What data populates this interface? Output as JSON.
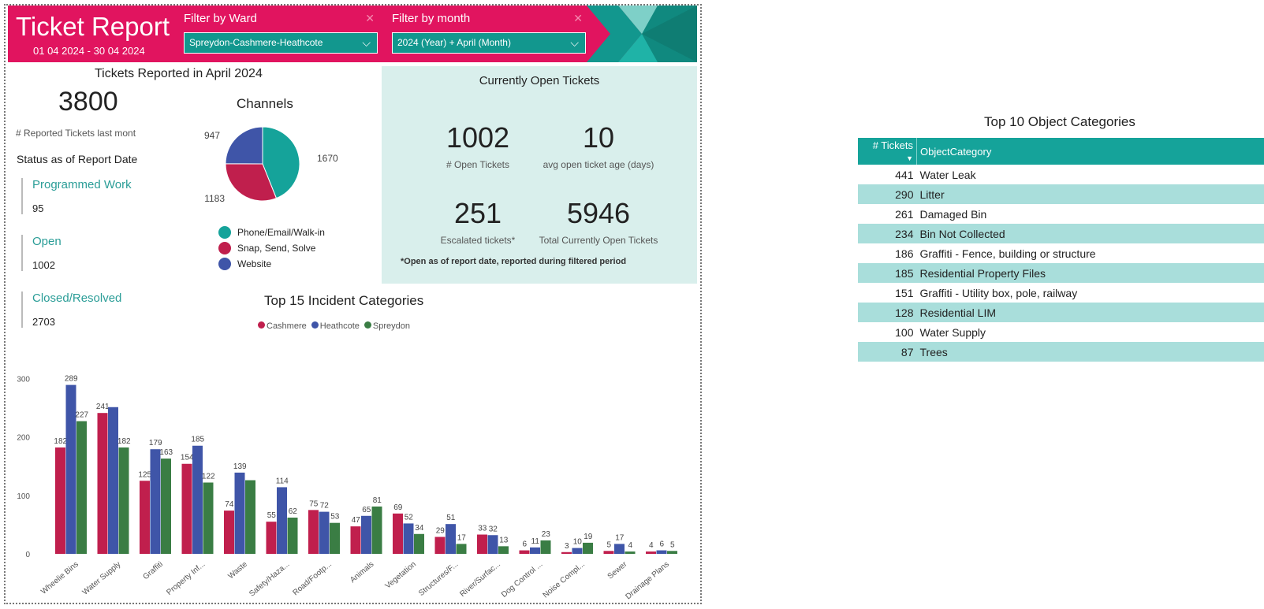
{
  "header": {
    "title": "Ticket Report",
    "dates": "01 04 2024 - 30 04 2024",
    "filters": [
      {
        "label": "Filter by Ward",
        "value": "Spreydon-Cashmere-Heathcote"
      },
      {
        "label": "Filter by month",
        "value": "2024 (Year) + April (Month)"
      }
    ]
  },
  "reported": {
    "title": "Tickets Reported in April 2024",
    "count": "3800",
    "count_label": "# Reported Tickets last mont",
    "status_title": "Status as of Report Date",
    "statuses": [
      {
        "label": "Programmed Work",
        "value": "95"
      },
      {
        "label": "Open",
        "value": "1002"
      },
      {
        "label": "Closed/Resolved",
        "value": "2703"
      }
    ]
  },
  "channels": {
    "title": "Channels",
    "slices": [
      {
        "name": "Phone/Email/Walk-in",
        "value": 1670,
        "label": "1670",
        "color": "#15a39a"
      },
      {
        "name": "Snap, Send, Solve",
        "value": 1183,
        "label": "1183",
        "color": "#c01f4d"
      },
      {
        "name": "Website",
        "value": 947,
        "label": "947",
        "color": "#3f55a8"
      }
    ]
  },
  "open_tickets": {
    "title": "Currently Open Tickets",
    "kpis": [
      {
        "value": "1002",
        "label": "# Open Tickets"
      },
      {
        "value": "10",
        "label": "avg open ticket age (days)"
      },
      {
        "value": "251",
        "label": "Escalated tickets*"
      },
      {
        "value": "5946",
        "label": "Total Currently Open Tickets"
      }
    ],
    "note": "*Open as of report date, reported during filtered period"
  },
  "chart_data": {
    "type": "bar",
    "title": "Top 15 Incident Categories",
    "categories": [
      "Wheelie Bins",
      "Water Supply",
      "Graffiti",
      "Property Inf...",
      "Waste",
      "Safety/Haza...",
      "Road/Footp...",
      "Animals",
      "Vegetation",
      "Structures/F...",
      "River/Surfac...",
      "Dog Control ...",
      "Noise Compl...",
      "Sewer",
      "Drainage Plans"
    ],
    "series": [
      {
        "name": "Cashmere",
        "color": "#c01f4d",
        "values": [
          182,
          241,
          125,
          154,
          74,
          55,
          75,
          47,
          69,
          29,
          33,
          6,
          3,
          5,
          4
        ]
      },
      {
        "name": "Heathcote",
        "color": "#3f55a8",
        "values": [
          289,
          251,
          179,
          185,
          139,
          114,
          72,
          65,
          52,
          51,
          32,
          11,
          10,
          17,
          6
        ]
      },
      {
        "name": "Spreydon",
        "color": "#3a7d44",
        "values": [
          227,
          182,
          163,
          122,
          126,
          62,
          53,
          81,
          34,
          17,
          13,
          23,
          19,
          4,
          5
        ]
      }
    ],
    "value_labels": [
      [
        "182",
        "241",
        "125",
        "154",
        "74",
        "55",
        "75",
        "47",
        "69",
        "29",
        "33",
        "6",
        "3",
        "5",
        "4"
      ],
      [
        "289",
        "",
        "179",
        "185",
        "139",
        "114",
        "72",
        "65",
        "52",
        "51",
        "32",
        "11",
        "10",
        "17",
        "6"
      ],
      [
        "227",
        "182",
        "163",
        "122",
        "",
        "62",
        "53",
        "81",
        "34",
        "17",
        "13",
        "23",
        "19",
        "4",
        "5"
      ]
    ],
    "yticks": [
      0,
      100,
      200,
      300
    ],
    "ylim": [
      0,
      310
    ],
    "legend": "top"
  },
  "objects": {
    "title": "Top 10 Object Categories",
    "headers": [
      "# Tickets",
      "ObjectCategory"
    ],
    "rows": [
      {
        "n": "441",
        "cat": "Water Leak"
      },
      {
        "n": "290",
        "cat": "Litter"
      },
      {
        "n": "261",
        "cat": "Damaged Bin"
      },
      {
        "n": "234",
        "cat": "Bin Not Collected"
      },
      {
        "n": "186",
        "cat": "Graffiti - Fence, building or structure"
      },
      {
        "n": "185",
        "cat": "Residential Property Files"
      },
      {
        "n": "151",
        "cat": "Graffiti - Utility box, pole, railway"
      },
      {
        "n": "128",
        "cat": "Residential LIM"
      },
      {
        "n": "100",
        "cat": "Water Supply"
      },
      {
        "n": "87",
        "cat": "Trees"
      }
    ]
  }
}
